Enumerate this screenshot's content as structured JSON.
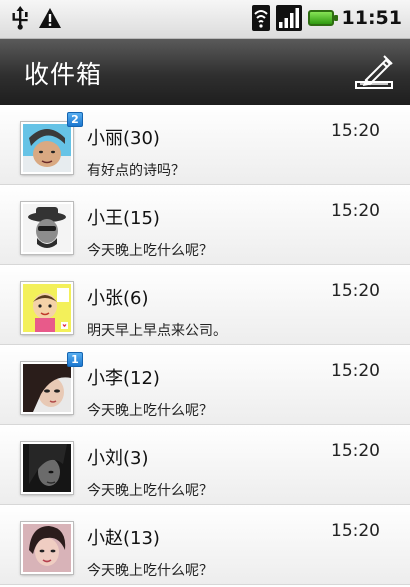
{
  "status_bar": {
    "time": "11:51",
    "icons": [
      "usb-icon",
      "warning-icon",
      "wifi-icon",
      "signal-icon",
      "battery-icon"
    ]
  },
  "header": {
    "title": "收件箱",
    "compose_icon": "compose-icon"
  },
  "messages": [
    {
      "name": "小丽(30)",
      "preview": "有好点的诗吗？",
      "time": "15:20",
      "badge": "2"
    },
    {
      "name": "小王(15)",
      "preview": "今天晚上吃什么呢？",
      "time": "15:20",
      "badge": ""
    },
    {
      "name": "小张(6)",
      "preview": "明天早上早点来公司。",
      "time": "15:20",
      "badge": ""
    },
    {
      "name": "小李(12)",
      "preview": "今天晚上吃什么呢？",
      "time": "15:20",
      "badge": "1"
    },
    {
      "name": "小刘(3)",
      "preview": "今天晚上吃什么呢？",
      "time": "15:20",
      "badge": ""
    },
    {
      "name": "小赵(13)",
      "preview": "今天晚上吃什么呢？",
      "time": "15:20",
      "badge": ""
    }
  ],
  "colors": {
    "title_bar": "#2f2f2f",
    "badge": "#1c78d0",
    "battery": "#3fae18"
  }
}
